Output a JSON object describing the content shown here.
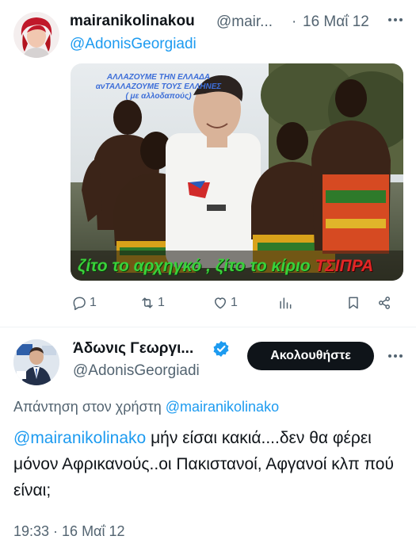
{
  "tweet1": {
    "name": "mairanikolinakou",
    "handle": "@mair...",
    "dot": "·",
    "date": "16 Μαΐ 12",
    "reply_to": "@AdonisGeorgiadi",
    "image": {
      "caption_top_lines": [
        "ΑΛΛΑΖΟΥΜΕ ΤΗΝ ΕΛΛΑΔΑ",
        "ανΤΑΛΛΑΖΟΥΜΕ ΤΟΥΣ ΕΛΛΗΝΕΣ",
        "( με αλλοδαπούς)"
      ],
      "caption_bottom": "ζίτο το αρχηγκό , ζίτο το κίριο",
      "caption_bottom_highlight": "ΤΣΙΠΡΑ"
    },
    "actions": {
      "reply_count": "1",
      "retweet_count": "1",
      "like_count": "1"
    }
  },
  "tweet2": {
    "name": "Άδωνις Γεωργι...",
    "handle": "@AdonisGeorgiadi",
    "follow_label": "Ακολουθήστε",
    "reply_context_prefix": "Απάντηση στον χρήστη",
    "reply_context_user": "@mairanikolinako",
    "mention": "@mairanikolinako",
    "body_text": "μήν είσαι κακιά....δεν θα φέρει μόνον Αφρικανούς..οι Πακιστανοί, Αφγανοί κλπ πού είναι;",
    "timestamp": "19:33 · 16 Μαΐ 12"
  },
  "colors": {
    "accent": "#1d9bf0",
    "muted_text": "#536471",
    "primary_text": "#0f1419",
    "verified": "#1d9bf0",
    "follow_button_bg": "#0f1419"
  },
  "icons": {
    "reply": "speech-bubble-icon",
    "retweet": "retweet-icon",
    "like": "heart-icon",
    "views": "bar-chart-icon",
    "bookmark": "bookmark-icon",
    "share": "share-icon",
    "more": "more-dots-icon",
    "verified": "verified-badge-icon"
  }
}
